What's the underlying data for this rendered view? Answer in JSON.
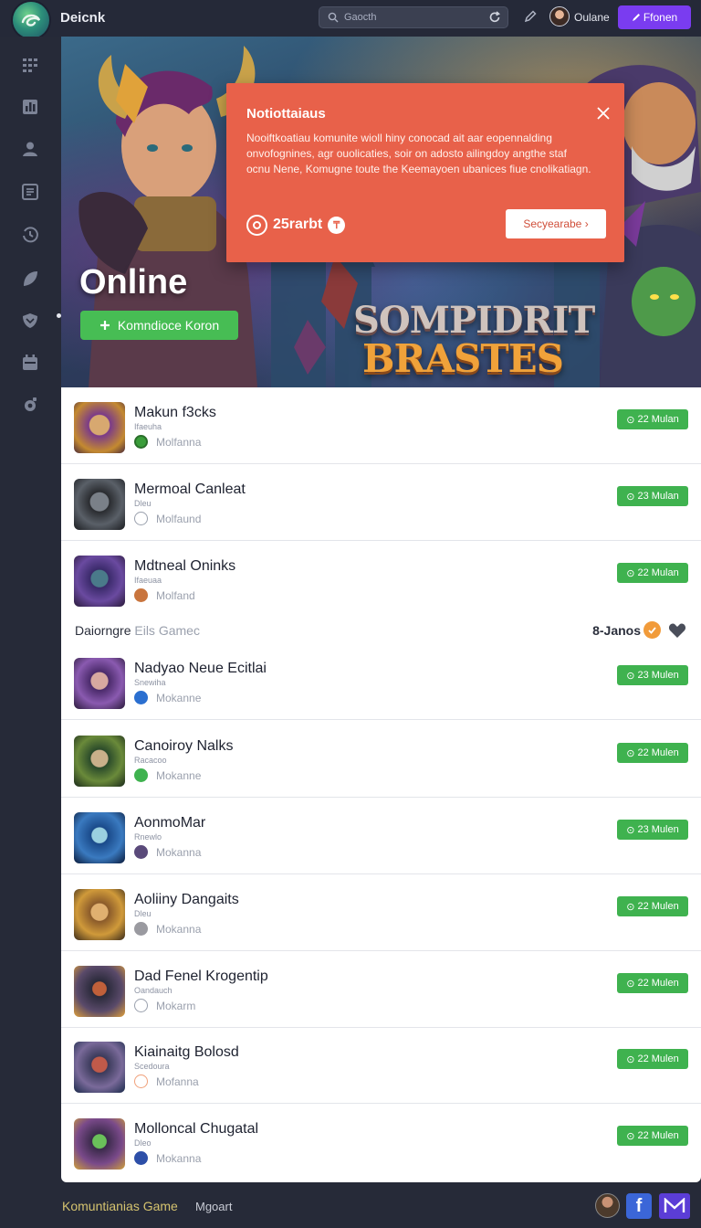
{
  "header": {
    "app_title": "Deicnk",
    "search_placeholder": "Gaocth",
    "user_name": "Oulane",
    "cta_label": "Ffonen",
    "icons": [
      "app-logo-icon",
      "search-icon",
      "refresh-icon",
      "pen-icon",
      "pencil-icon"
    ]
  },
  "sidebar": {
    "items": [
      {
        "icon": "grid-icon"
      },
      {
        "icon": "chart-icon"
      },
      {
        "icon": "user-icon"
      },
      {
        "icon": "document-icon"
      },
      {
        "icon": "history-icon"
      },
      {
        "icon": "leaf-icon"
      },
      {
        "icon": "shield-icon"
      },
      {
        "icon": "calendar-icon"
      },
      {
        "icon": "settings-icon"
      }
    ]
  },
  "hero": {
    "title": "Online",
    "button_label": "Komndioce Koron",
    "wordmark_line1": "SOMPIDRIT",
    "wordmark_line2": "BRASTES"
  },
  "notification": {
    "title": "Notiottaiaus",
    "body": "Nooiftkoatiau komunite wioll hiny conocad ait aar eopennalding onvofognines, agr ouolicaties, soir on adosto ailingdoy angthe staf ocnu Nene, Komugne toute the Keemayoen ubanices fiue cnolikatiagn.",
    "stat_value": "25rarbt",
    "button_label": "Secyearabe ›"
  },
  "list": {
    "rows": [
      {
        "title": "Makun f3cks",
        "sub": "Ifaeuha",
        "meta": "Molfanna",
        "badge": "22 Mulan",
        "dot_color": "#3a9d3a"
      },
      {
        "title": "Mermoal Canleat",
        "sub": "Dleu",
        "meta": "Molfaund",
        "badge": "23 Mulan",
        "dot_color": "#ffffff"
      },
      {
        "title": "Mdtneal Oninks",
        "sub": "Ifaeuaa",
        "meta": "Molfand",
        "badge": "22 Mulan",
        "dot_color": "#c9753e"
      }
    ],
    "section": {
      "title": "Daiorngre",
      "title_muted": " Eils Gamec",
      "count": "8-Janos"
    },
    "rows2": [
      {
        "title": "Nadyao Neue Ecitlai",
        "sub": "Snewiha",
        "meta": "Mokanne",
        "badge": "23 Mulen",
        "dot_color": "#2b6fd0"
      },
      {
        "title": "Canoiroy Nalks",
        "sub": "Racacoo",
        "meta": "Mokanne",
        "badge": "22 Mulen",
        "dot_color": "#3fb24f"
      },
      {
        "title": "AonmoMar",
        "sub": "Rnewlo",
        "meta": "Mokanna",
        "badge": "23 Mulen",
        "dot_color": "#5a4a7a"
      },
      {
        "title": "Aoliiny Dangaits",
        "sub": "Dleu",
        "meta": "Mokanna",
        "badge": "22 Mulen",
        "dot_color": "#9a9aa0"
      },
      {
        "title": "Dad Fenel Krogentip",
        "sub": "Oandauch",
        "meta": "Mokarm",
        "badge": "22 Mulen",
        "dot_color": "#ffffff"
      },
      {
        "title": "Kiainaitg Bolosd",
        "sub": "Scedoura",
        "meta": "Mofanna",
        "badge": "22 Mulen",
        "dot_color": "#f0a07a"
      },
      {
        "title": "Molloncal Chugatal",
        "sub": "Dleo",
        "meta": "Mokanna",
        "badge": "22 Mulen",
        "dot_color": "#2d4fa8"
      }
    ]
  },
  "footer": {
    "brand": "Komuntianias Game",
    "link": "Mgoart"
  },
  "colors": {
    "accent_purple": "#7a3cf0",
    "accent_green": "#3fb24f",
    "notice_orange": "#e8614a",
    "background_dark": "#262a38"
  }
}
